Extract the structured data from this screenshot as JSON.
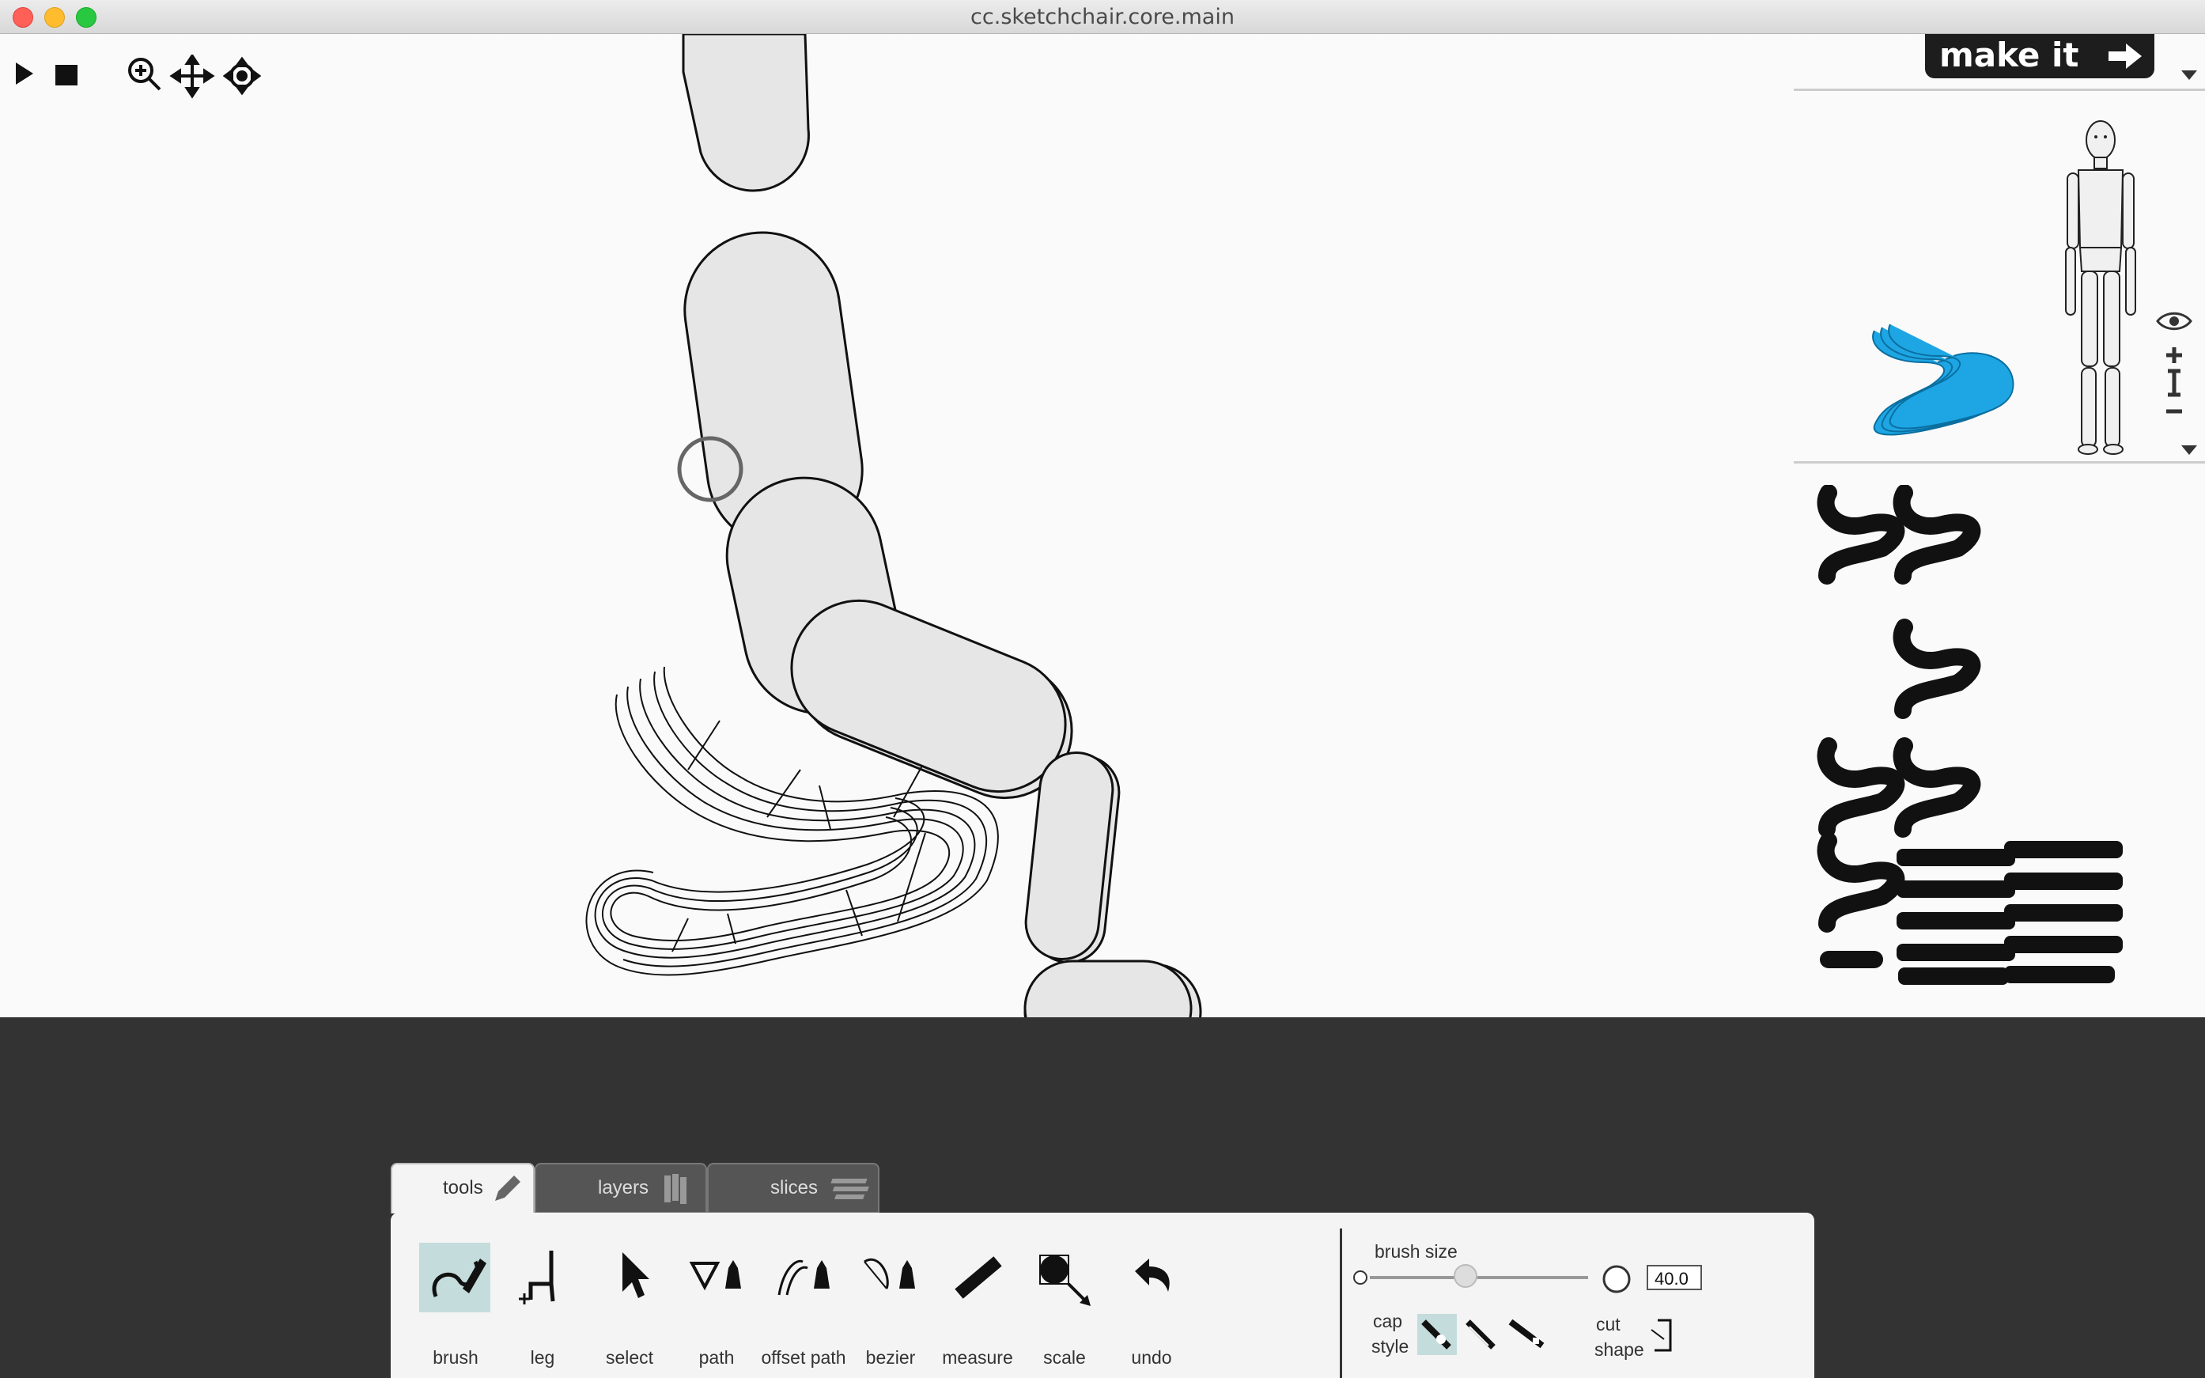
{
  "window": {
    "title": "cc.sketchchair.core.main"
  },
  "toolbar": {
    "play": "play-icon",
    "stop": "stop-icon",
    "zoom": "zoom-in-icon",
    "pan": "move-icon",
    "rotate": "rotate-icon"
  },
  "make_it": {
    "label": "make it"
  },
  "tabs": [
    {
      "label": "tools"
    },
    {
      "label": "layers"
    },
    {
      "label": "slices"
    }
  ],
  "tools": [
    {
      "label": "brush",
      "icon": "brush-icon"
    },
    {
      "label": "leg",
      "icon": "leg-icon"
    },
    {
      "label": "select",
      "icon": "select-icon"
    },
    {
      "label": "path",
      "icon": "path-icon"
    },
    {
      "label": "offset path",
      "icon": "offset-path-icon"
    },
    {
      "label": "bezier",
      "icon": "bezier-icon"
    },
    {
      "label": "measure",
      "icon": "measure-icon"
    },
    {
      "label": "scale",
      "icon": "scale-icon"
    },
    {
      "label": "undo",
      "icon": "undo-icon"
    }
  ],
  "brush": {
    "size_label": "brush size",
    "size_value": "40.0",
    "cap_label_1": "cap",
    "cap_label_2": "style",
    "cut_label_1": "cut",
    "cut_label_2": "shape"
  },
  "colors": {
    "accent_blue": "#1ea6e4",
    "selected_tool": "#c5dcdc",
    "dark_bg": "#333333",
    "canvas": "#fafafa"
  }
}
